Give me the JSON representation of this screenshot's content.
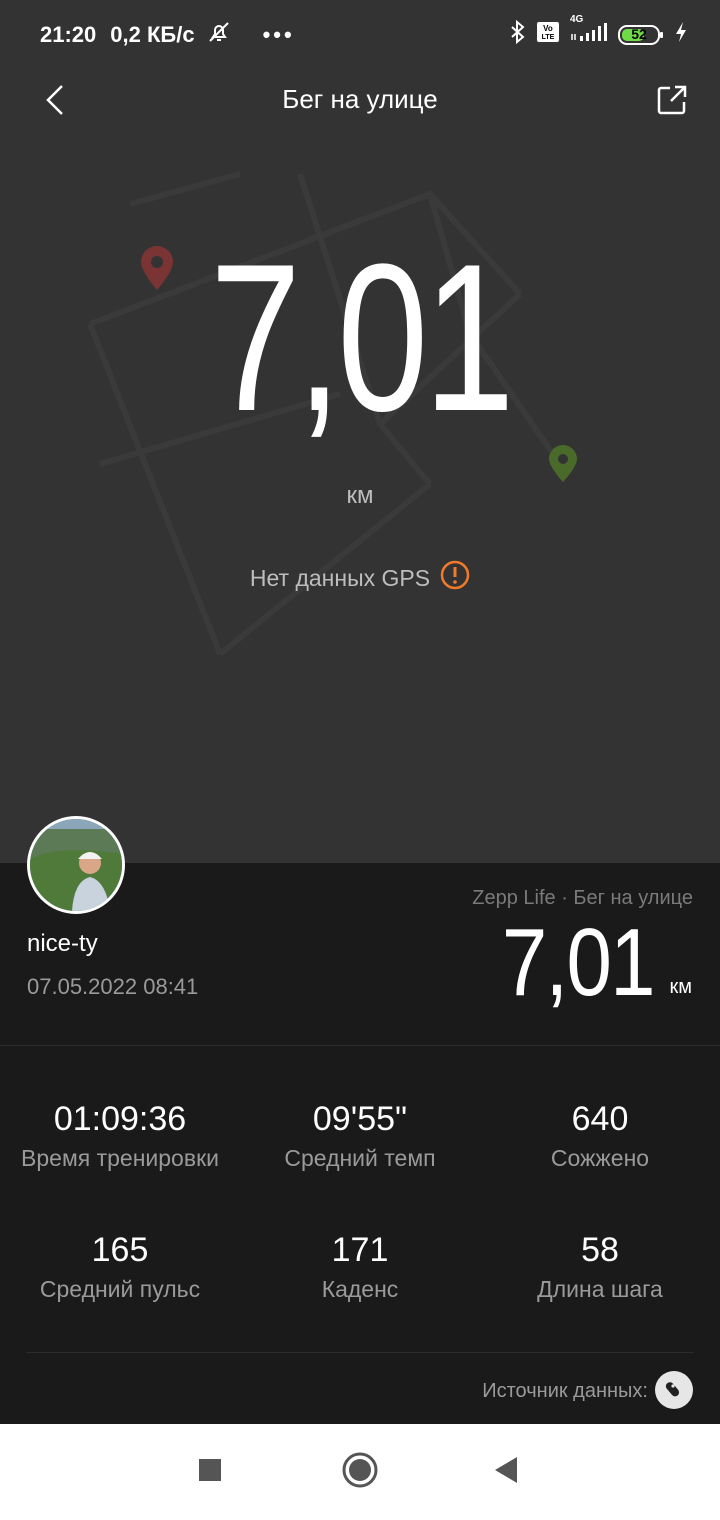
{
  "status_bar": {
    "time": "21:20",
    "net_speed": "0,2 КБ/с",
    "dots": "•••",
    "network": "4G",
    "battery": "52",
    "icons": [
      "mute-bell-icon",
      "bluetooth-icon",
      "volte-icon",
      "signal-icon",
      "battery-icon",
      "charging-icon"
    ]
  },
  "header": {
    "title": "Бег на улице",
    "back_icon": "chevron-left-icon",
    "share_icon": "share-icon"
  },
  "map": {
    "distance": "7,01",
    "unit": "км",
    "gps_message": "Нет данных GPS",
    "start_pin_color": "#8a3a3a",
    "end_pin_color": "#4a6a2a"
  },
  "card": {
    "username": "nice-ty",
    "datetime": "07.05.2022 08:41",
    "source_line": "Zepp Life · Бег на улице",
    "distance": "7,01",
    "unit": "км"
  },
  "stats": [
    {
      "value": "01:09:36",
      "label": "Время тренировки"
    },
    {
      "value": "09'55\"",
      "label": "Средний темп"
    },
    {
      "value": "640",
      "label": "Сожжено"
    },
    {
      "value": "165",
      "label": "Средний пульс"
    },
    {
      "value": "171",
      "label": "Каденс"
    },
    {
      "value": "58",
      "label": "Длина шага"
    }
  ],
  "data_source": {
    "label": "Источник данных:",
    "icon": "band-icon"
  },
  "colors": {
    "warning": "#f07a2a",
    "background": "#333333",
    "panel": "#1a1a1a"
  }
}
